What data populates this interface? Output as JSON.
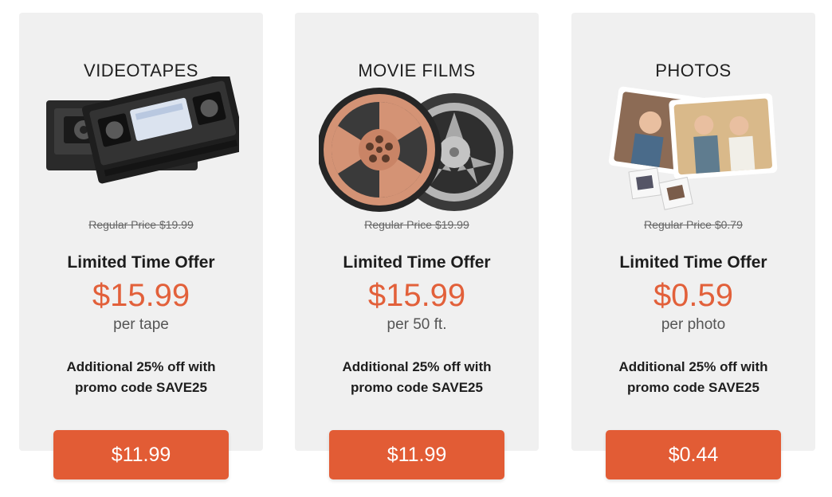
{
  "colors": {
    "accent": "#e2603a",
    "button": "#e25c35",
    "card": "#f0f0f0"
  },
  "cards": [
    {
      "title": "VIDEOTAPES",
      "image": "videotape-cassettes",
      "regular_price": "Regular Price $19.99",
      "offer": "Limited Time Offer",
      "price": "$15.99",
      "unit": "per tape",
      "promo_line1": "Additional 25% off with",
      "promo_line2": "promo code SAVE25",
      "button": "$11.99"
    },
    {
      "title": "MOVIE FILMS",
      "image": "film-reels",
      "regular_price": "Regular Price $19.99",
      "offer": "Limited Time Offer",
      "price": "$15.99",
      "unit": "per 50 ft.",
      "promo_line1": "Additional 25% off with",
      "promo_line2": "promo code SAVE25",
      "button": "$11.99"
    },
    {
      "title": "PHOTOS",
      "image": "photo-prints-and-slides",
      "regular_price": "Regular Price $0.79",
      "offer": "Limited Time Offer",
      "price": "$0.59",
      "unit": "per photo",
      "promo_line1": "Additional 25% off with",
      "promo_line2": "promo code SAVE25",
      "button": "$0.44"
    }
  ]
}
